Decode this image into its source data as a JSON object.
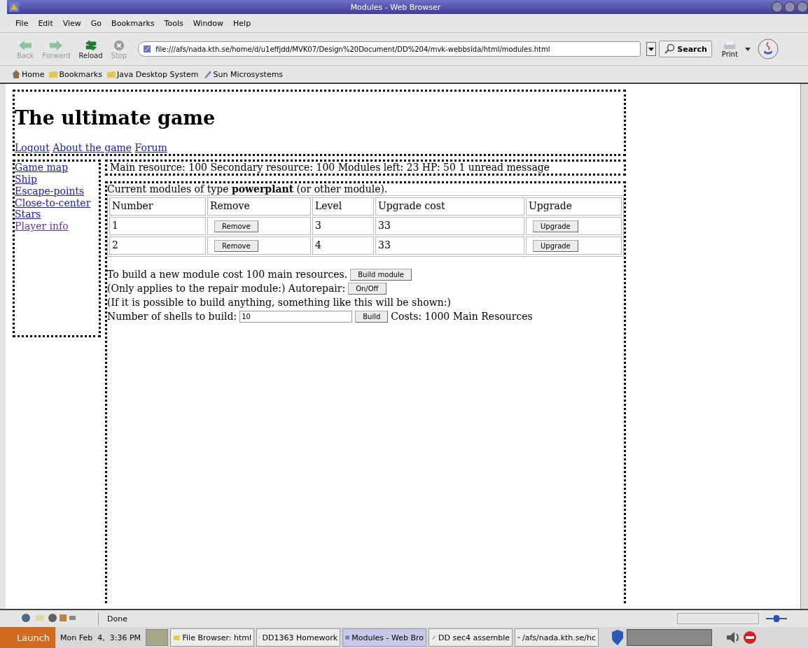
{
  "window": {
    "title": "Modules - Web Browser"
  },
  "menu": [
    "File",
    "Edit",
    "View",
    "Go",
    "Bookmarks",
    "Tools",
    "Window",
    "Help"
  ],
  "nav_buttons": [
    {
      "label": "Back",
      "disabled": true,
      "kind": "back"
    },
    {
      "label": "Forward",
      "disabled": true,
      "kind": "forward"
    },
    {
      "label": "Reload",
      "disabled": false,
      "kind": "reload"
    },
    {
      "label": "Stop",
      "disabled": true,
      "kind": "stop"
    }
  ],
  "address": {
    "value": "file:///afs/nada.kth.se/home/d/u1effjdd/MVK07/Design%20Document/DD%204/mvk-webbsida/html/modules.html"
  },
  "search_button": "Search",
  "print_button": "Print",
  "bookmarks": [
    {
      "label": "Home",
      "kind": "home"
    },
    {
      "label": "Bookmarks",
      "kind": "folder"
    },
    {
      "label": "Java Desktop System",
      "kind": "folder"
    },
    {
      "label": "Sun Microsystems",
      "kind": "pen"
    }
  ],
  "page": {
    "heading": "The ultimate game",
    "top_links": [
      "Logout",
      "About the game",
      "Forum"
    ],
    "nav_links": [
      {
        "label": "Game map",
        "visited": false
      },
      {
        "label": "Ship",
        "visited": false
      },
      {
        "label": "Escape-points",
        "visited": false
      },
      {
        "label": "Close-to-center",
        "visited": false
      },
      {
        "label": "Stars",
        "visited": false
      },
      {
        "label": "Player info",
        "visited": true
      }
    ],
    "status_line": "Main resource: 100 Secondary resource: 100 Modules left: 23 HP: 50 1 unread message",
    "caption": "Current modules of type **powerplant** (or other module).",
    "table": {
      "columns": [
        "Number",
        "Remove",
        "Level",
        "Upgrade cost",
        "Upgrade"
      ],
      "rows": [
        {
          "number": "1",
          "remove": "Remove",
          "level": "3",
          "cost": "33",
          "upgrade": "Upgrade"
        },
        {
          "number": "2",
          "remove": "Remove",
          "level": "4",
          "cost": "33",
          "upgrade": "Upgrade"
        }
      ]
    },
    "build_text": "To build a new module cost 100 main resources.",
    "build_button": "Build module",
    "autorepair_text": "(Only applies to the repair module:) Autorepair:",
    "autorepair_button": "On/Off",
    "note": "(If it is possible to build anything, something like this will be shown:)",
    "shells_label": "Number of shells to build:",
    "shells_value": "10",
    "shells_button": "Build",
    "shells_cost": "Costs: 1000 Main Resources"
  },
  "status_bar": {
    "text": "Done"
  },
  "taskbar": {
    "launch": "Launch",
    "clock": "Mon Feb  4,  3:36 PM",
    "tasks": [
      {
        "label": "File Browser: html",
        "selected": false,
        "kind": "folder"
      },
      {
        "label": "DD1363 Homework",
        "selected": false,
        "kind": "browser"
      },
      {
        "label": "Modules - Web Bro",
        "selected": true,
        "kind": "browser"
      },
      {
        "label": "DD sec4 assemble",
        "selected": false,
        "kind": "editor"
      },
      {
        "label": "/afs/nada.kth.se/hc",
        "selected": false,
        "kind": "terminal"
      }
    ]
  }
}
